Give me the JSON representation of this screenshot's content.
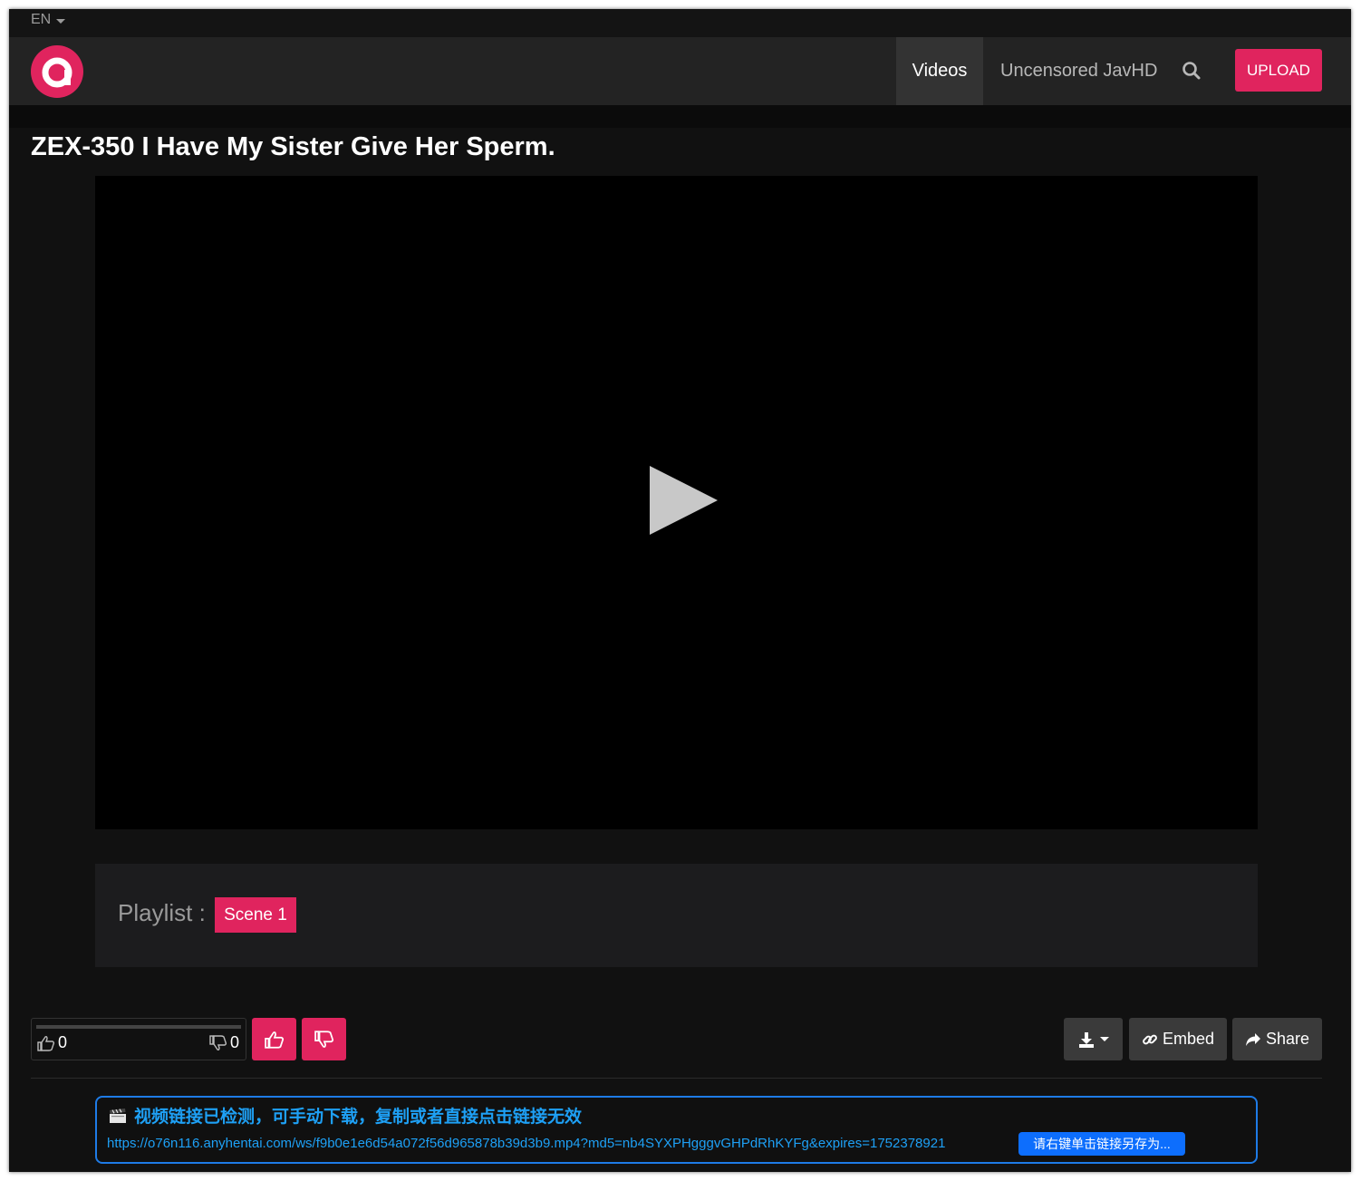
{
  "header": {
    "language": "EN",
    "nav": {
      "videos": "Videos",
      "uncensored": "Uncensored JavHD"
    },
    "upload_label": "UPLOAD"
  },
  "video": {
    "title": "ZEX-350 I Have My Sister Give Her Sperm."
  },
  "playlist": {
    "label": "Playlist :",
    "items": [
      "Scene 1"
    ]
  },
  "rating": {
    "likes": "0",
    "dislikes": "0"
  },
  "actions": {
    "embed_label": "Embed",
    "share_label": "Share"
  },
  "detector": {
    "heading": "视频链接已检测，可手动下载，复制或者直接点击链接无效",
    "url": "https://o76n116.anyhentai.com/ws/f9b0e1e6d54a072f56d965878b39d3b9.mp4?md5=nb4SYXPHgggvGHPdRhKYFg&expires=1752378921",
    "save_label": "请右键单击链接另存为..."
  },
  "colors": {
    "accent": "#e0245e",
    "background": "#111111",
    "nav_background": "#232323",
    "detector_blue": "#1ea0f5"
  }
}
